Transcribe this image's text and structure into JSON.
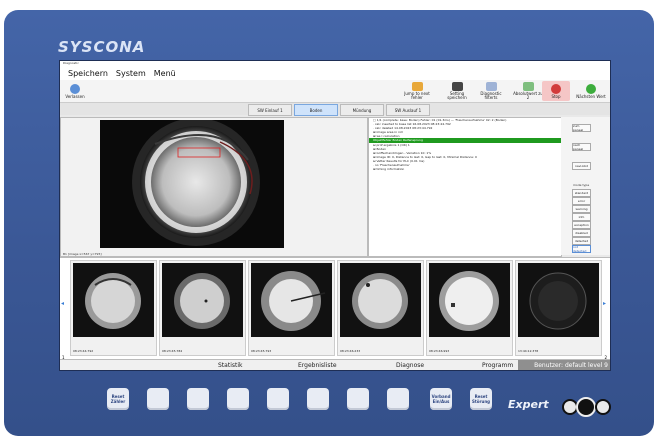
{
  "brand": "SYSCONA",
  "window_title": "Diagnostic",
  "menu": [
    "Speichern",
    "System",
    "Menü"
  ],
  "toolbar": {
    "left_button": "Verlassen",
    "buttons": [
      "Jump to next\nfehler",
      "Setting\nspeichern",
      "Diagnostic\nfilterts",
      "Absolutwert\nzu 2",
      "Stop",
      "Nächsten Wert"
    ]
  },
  "tabs": [
    "SW Einlauf 1",
    "Boden",
    "Mündung",
    "SW Auslauf 1"
  ],
  "active_tab": "Boden",
  "image_caption": "B1 [image x=567 y=795]",
  "tree_lines": [
    "□ 1/1 (complete: base: Boden) Fehler: 01 (01.3ms) — 'Flaschenaufnahme' 02: 2 (Boden)",
    "   · calc inserted to base list 16.08.2023 08:23:44.792",
    "   · calc deleted 14.08.2023 08:23:44.792",
    "   ⊞ image area in roll",
    "   ⊞ ws I calculation",
    "   ⊟ prüf ergebnis 1 (OK) 1",
    "   ⊞ Boden",
    "   ⊞ Griffechandimgen - Variation 10: 1%",
    "   ⊞ Image ID: 0, Distance to last: 0, Gap to last: 0, Minimal Distance: 0",
    "   ⊟ Vetter Results for PLC (0.01 ms)",
    "      · no 'Flaschenaufnahme'",
    "   ⊞ timing information"
  ],
  "tree_highlight": "  Objektfehler Boden Reifensprung",
  "side_buttons": [
    "zum paneal",
    "nach paneal",
    "navi-kbd"
  ],
  "mode": {
    "label": "mode type",
    "options": [
      "standard",
      "error",
      "warning",
      "info",
      "exception",
      "disabled",
      "detected",
      "not detected"
    ]
  },
  "thumbnails": [
    {
      "time": "08:23:44.792"
    },
    {
      "time": "08:23:45.784"
    },
    {
      "time": "08:23:45.793"
    },
    {
      "time": "08:23:46.233"
    },
    {
      "time": "08:23:46.993"
    },
    {
      "time": "13:44:12.378"
    }
  ],
  "thumb_index_left": "1",
  "thumb_index_right": "2",
  "statusbar": {
    "statistik": "Statistik",
    "ergebnisliste": "Ergebnisliste",
    "diagnose": "Diagnose",
    "programm": "Programm",
    "benutzer": "Benutzer: default level 9"
  },
  "keys": [
    {
      "label": "Reset\nZähler"
    },
    {
      "label": ""
    },
    {
      "label": ""
    },
    {
      "label": ""
    },
    {
      "label": ""
    },
    {
      "label": ""
    },
    {
      "label": ""
    },
    {
      "label": ""
    },
    {
      "label": "Vorband\nEin/Aus"
    },
    {
      "label": "Reset\nStörung"
    }
  ],
  "expert_label": "Expert",
  "colors": {
    "bezel": "#3d5a9a",
    "highlight": "#1f9a1f",
    "tab_active": "#cfe3fb",
    "stop": "#d23b3b",
    "go": "#3dad3d"
  }
}
